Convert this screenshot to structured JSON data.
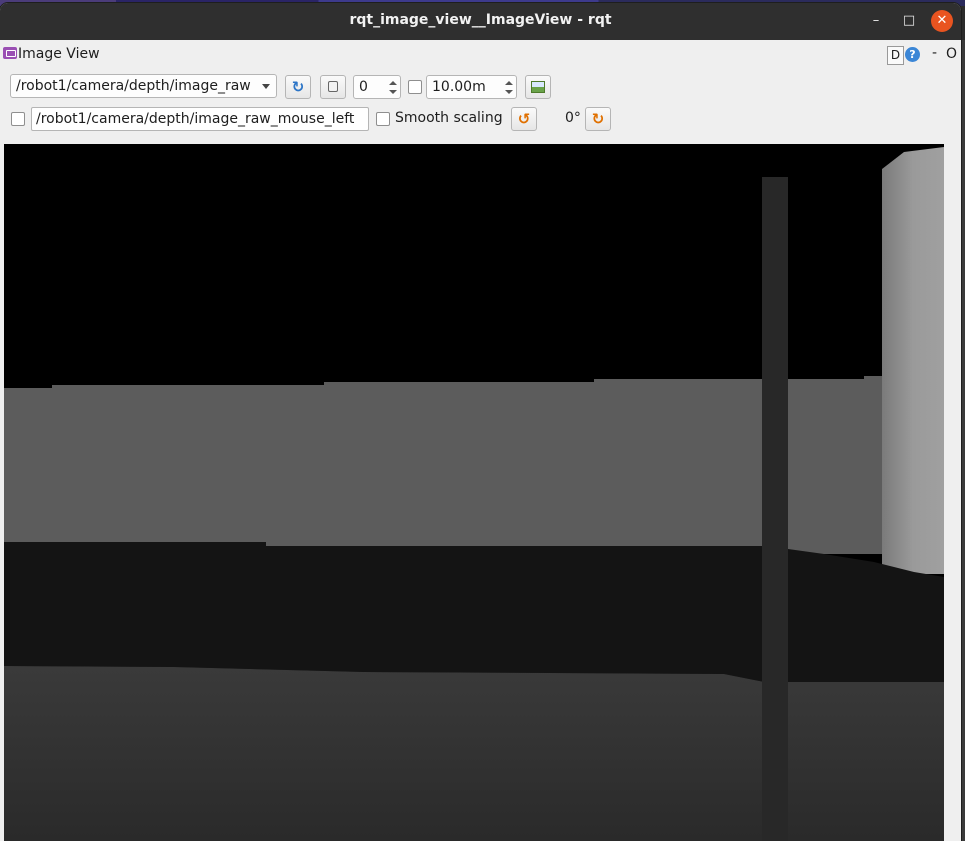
{
  "window": {
    "title": "rqt_image_view__ImageView - rqt",
    "minimize_glyph": "–",
    "maximize_glyph": "□",
    "close_glyph": "✕"
  },
  "plugin": {
    "title": "Image View",
    "icon": "image-view-icon",
    "help_d": "D",
    "help_q": "?",
    "dash": "-",
    "o": "O"
  },
  "toolbar": {
    "topic": "/robot1/camera/depth/image_raw",
    "refresh_glyph": "↻",
    "num_value": "0",
    "max_range": "10.00m",
    "mouse_topic": "/robot1/camera/depth/image_raw_mouse_left",
    "smooth_label": "Smooth scaling",
    "rotate_left_glyph": "↺",
    "rotation": "0°",
    "rotate_right_glyph": "↻"
  },
  "colors": {
    "titlebar": "#2f2f2f",
    "close_button": "#e95420",
    "panel": "#efefef",
    "image_background": "#000000"
  }
}
